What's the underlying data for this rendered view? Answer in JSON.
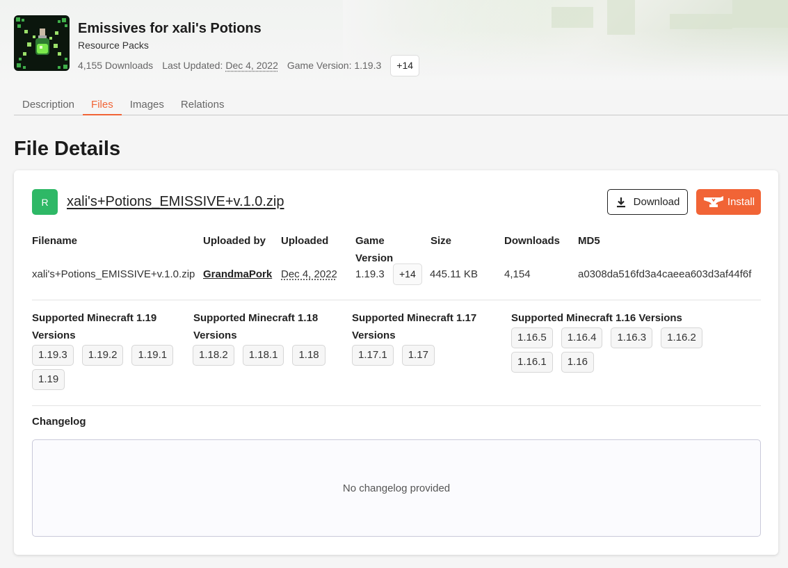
{
  "project": {
    "title": "Emissives for xali's Potions",
    "category": "Resource Packs",
    "downloads": "4,155 Downloads",
    "last_updated_label": "Last Updated:",
    "last_updated_value": "Dec 4, 2022",
    "game_version": "Game Version: 1.19.3",
    "more_versions": "+14"
  },
  "tabs": [
    {
      "label": "Description"
    },
    {
      "label": "Files"
    },
    {
      "label": "Images"
    },
    {
      "label": "Relations"
    }
  ],
  "page_title": "File Details",
  "file": {
    "release_badge": "R",
    "name": "xali's+Potions_EMISSIVE+v.1.0.zip",
    "download_label": "Download",
    "install_label": "Install",
    "columns": {
      "filename": "Filename",
      "uploaded_by": "Uploaded by",
      "uploaded": "Uploaded",
      "game_version": "Game Version",
      "size": "Size",
      "downloads": "Downloads",
      "md5": "MD5"
    },
    "values": {
      "filename": "xali's+Potions_EMISSIVE+v.1.0.zip",
      "uploaded_by": "GrandmaPork",
      "uploaded": "Dec 4, 2022",
      "game_version": "1.19.3",
      "game_version_more": "+14",
      "size": "445.11 KB",
      "downloads": "4,154",
      "md5": "a0308da516fd3a4caeea603d3af44f6f"
    }
  },
  "supported": [
    {
      "title": "Supported Minecraft 1.19 Versions",
      "versions": [
        "1.19.3",
        "1.19.2",
        "1.19.1",
        "1.19"
      ]
    },
    {
      "title": "Supported Minecraft 1.18 Versions",
      "versions": [
        "1.18.2",
        "1.18.1",
        "1.18"
      ]
    },
    {
      "title": "Supported Minecraft 1.17 Versions",
      "versions": [
        "1.17.1",
        "1.17"
      ]
    },
    {
      "title": "Supported Minecraft 1.16 Versions",
      "versions": [
        "1.16.5",
        "1.16.4",
        "1.16.3",
        "1.16.2",
        "1.16.1",
        "1.16"
      ]
    }
  ],
  "changelog": {
    "label": "Changelog",
    "empty_text": "No changelog provided"
  },
  "colors": {
    "accent": "#f16436",
    "release": "#2eb866"
  }
}
